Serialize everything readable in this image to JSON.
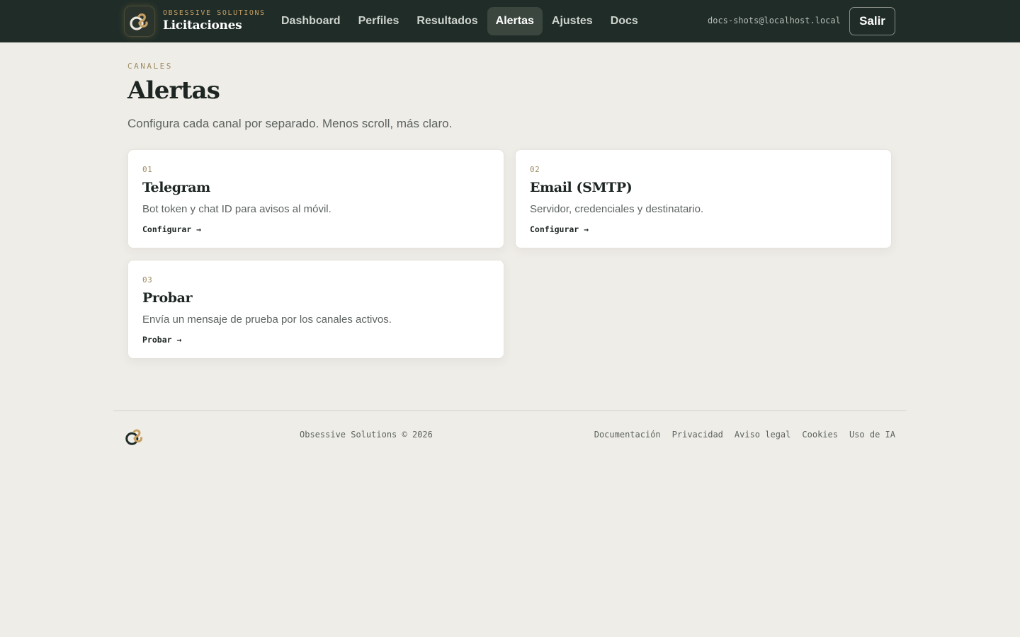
{
  "brand": {
    "kicker": "OBSESSIVE SOLUTIONS",
    "title": "Licitaciones"
  },
  "nav": {
    "items": [
      {
        "label": "Dashboard",
        "active": false
      },
      {
        "label": "Perfiles",
        "active": false
      },
      {
        "label": "Resultados",
        "active": false
      },
      {
        "label": "Alertas",
        "active": true
      },
      {
        "label": "Ajustes",
        "active": false
      },
      {
        "label": "Docs",
        "active": false
      }
    ]
  },
  "user": {
    "email": "docs-shots@localhost.local",
    "logout_label": "Salir"
  },
  "header": {
    "kicker": "CANALES",
    "title": "Alertas",
    "subtitle": "Configura cada canal por separado. Menos scroll, más claro."
  },
  "cards": [
    {
      "num": "01",
      "title": "Telegram",
      "desc": "Bot token y chat ID para avisos al móvil.",
      "link": "Configurar →"
    },
    {
      "num": "02",
      "title": "Email (SMTP)",
      "desc": "Servidor, credenciales y destinatario.",
      "link": "Configurar →"
    },
    {
      "num": "03",
      "title": "Probar",
      "desc": "Envía un mensaje de prueba por los canales activos.",
      "link": "Probar →"
    }
  ],
  "footer": {
    "copyright": "Obsessive Solutions © 2026",
    "links": [
      "Documentación",
      "Privacidad",
      "Aviso legal",
      "Cookies",
      "Uso de IA"
    ]
  },
  "colors": {
    "topbar_bg": "#1f2c28",
    "accent_gold": "#c8a063",
    "page_bg": "#efede8"
  },
  "icons": {
    "brand_logo": "brand-logo-icon",
    "footer_logo": "footer-logo-icon"
  }
}
